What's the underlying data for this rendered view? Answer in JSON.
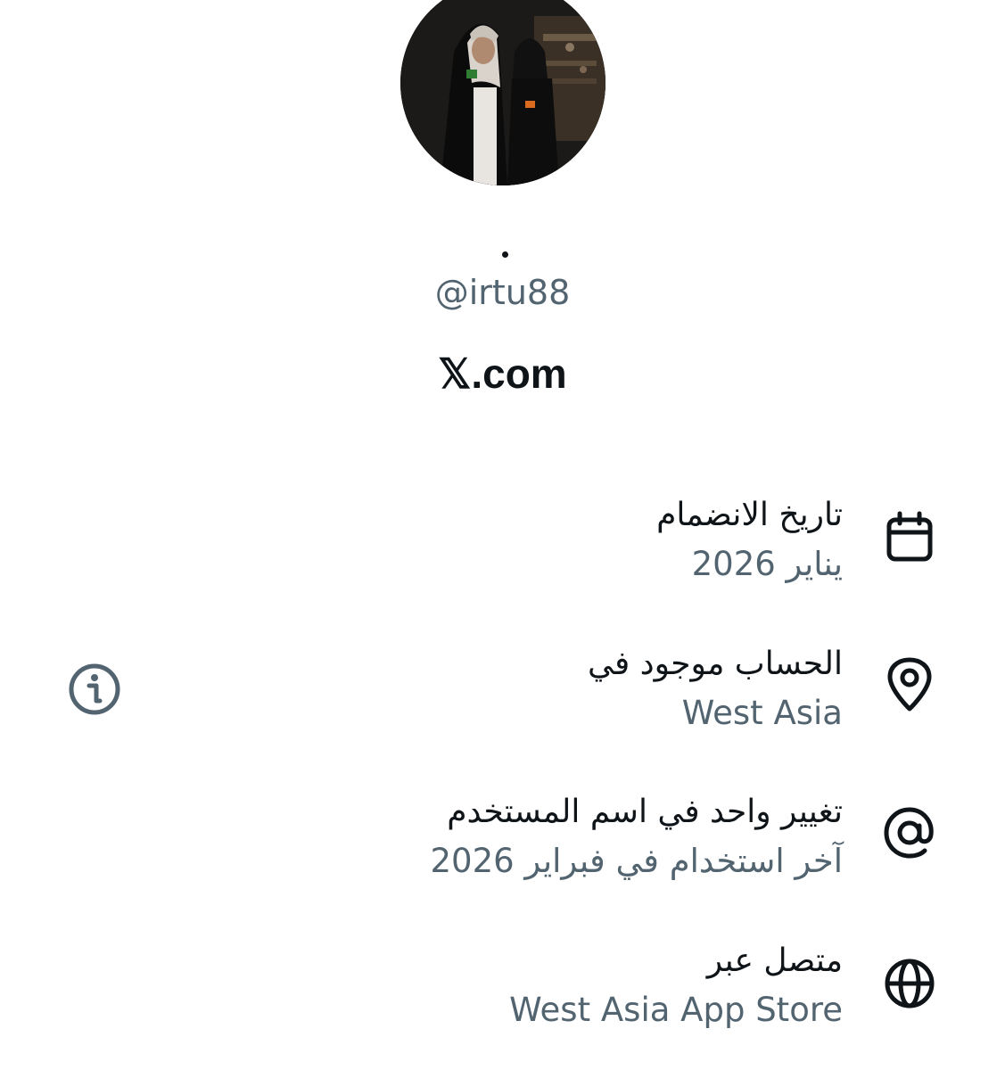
{
  "profile": {
    "handle": "@irtu88",
    "website": "𝕏.com",
    "avatar_icon": "profile-photo"
  },
  "about": {
    "rows": [
      {
        "icon": "calendar-icon",
        "title": "تاريخ الانضمام",
        "value": "يناير 2026"
      },
      {
        "icon": "location-pin-icon",
        "title": "الحساب موجود في",
        "value": "West Asia"
      },
      {
        "icon": "at-sign-icon",
        "title": "تغيير واحد في اسم المستخدم",
        "value": "آخر استخدام في فبراير 2026"
      },
      {
        "icon": "globe-icon",
        "title": "متصل عبر",
        "value": "West Asia App Store"
      }
    ],
    "info_icon": "info-icon"
  },
  "colors": {
    "primary_text": "#0f1419",
    "secondary_text": "#536471"
  }
}
